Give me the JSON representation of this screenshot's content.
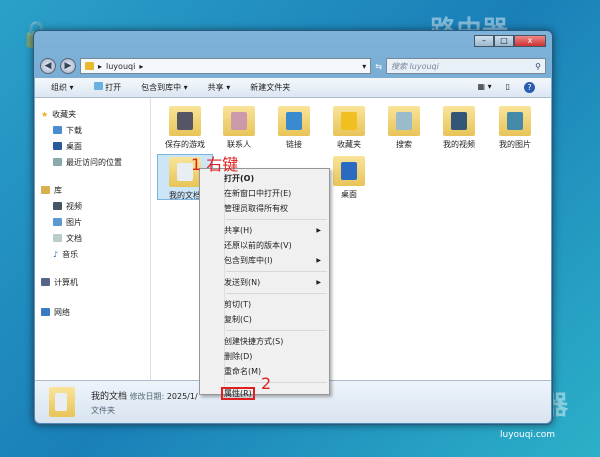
{
  "watermark": "路由器",
  "watermark_url": "luyouqi.com",
  "window": {
    "buttons": {
      "minimize": "–",
      "maximize": "□",
      "close": "x"
    }
  },
  "address": {
    "path": "luyouqi",
    "search_placeholder": "搜索 luyouqi"
  },
  "toolbar": {
    "organize": "组织 ▾",
    "open": "打开",
    "include": "包含到库中 ▾",
    "share": "共享 ▾",
    "new_folder": "新建文件夹"
  },
  "sidebar": {
    "favorites": "收藏夹",
    "fav_items": [
      "下载",
      "桌面",
      "最近访问的位置"
    ],
    "libraries": "库",
    "lib_items": [
      "视频",
      "图片",
      "文档",
      "音乐"
    ],
    "computer": "计算机",
    "network": "网络"
  },
  "folders": [
    "保存的游戏",
    "联系人",
    "链接",
    "收藏夹",
    "搜索",
    "我的视频",
    "我的图片",
    "我的文档",
    "桌面"
  ],
  "context_menu": [
    "打开(O)",
    "在新窗口中打开(E)",
    "管理员取得所有权",
    "共享(H)",
    "还原以前的版本(V)",
    "包含到库中(I)",
    "发送到(N)",
    "剪切(T)",
    "复制(C)",
    "创建快捷方式(S)",
    "删除(D)",
    "重命名(M)",
    "属性(R)"
  ],
  "annotations": {
    "step1": "1 右键",
    "step2": "2"
  },
  "status": {
    "name": "我的文档",
    "date_label": "修改日期:",
    "date": "2025/1/",
    "type": "文件夹"
  }
}
